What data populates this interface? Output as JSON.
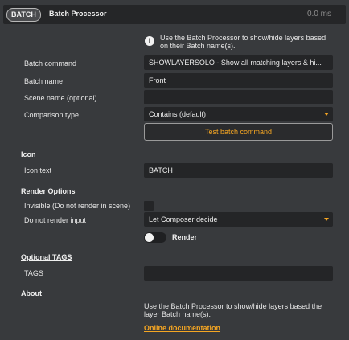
{
  "header": {
    "badge": "BATCH",
    "title": "Batch Processor",
    "timing": "0.0 ms"
  },
  "info": {
    "icon": "info-icon",
    "text": "Use the Batch Processor to show/hide layers based on their Batch name(s)."
  },
  "form": {
    "batch_command_label": "Batch command",
    "batch_command_value": "SHOWLAYERSOLO - Show all matching layers & hi...",
    "batch_name_label": "Batch name",
    "batch_name_value": "Front",
    "scene_name_label": "Scene name (optional)",
    "scene_name_value": "",
    "comparison_label": "Comparison type",
    "comparison_value": "Contains (default)",
    "test_button": "Test batch command"
  },
  "icon_section": {
    "heading": "Icon",
    "icon_text_label": "Icon text",
    "icon_text_value": "BATCH"
  },
  "render": {
    "heading": "Render Options",
    "invisible_label": "Invisible (Do not render in scene)",
    "invisible_checked": false,
    "do_not_render_label": "Do not render input",
    "do_not_render_value": "Let Composer decide",
    "render_toggle_label": "Render",
    "render_toggle_on": false
  },
  "tags": {
    "heading": "Optional TAGS",
    "label": "TAGS",
    "value": ""
  },
  "about": {
    "heading": "About",
    "text": "Use the Batch Processor to show/hide layers based the layer Batch name(s).",
    "link": "Online documentation"
  },
  "colors": {
    "accent": "#f5a623",
    "background": "#383a3d",
    "field": "#242527"
  }
}
